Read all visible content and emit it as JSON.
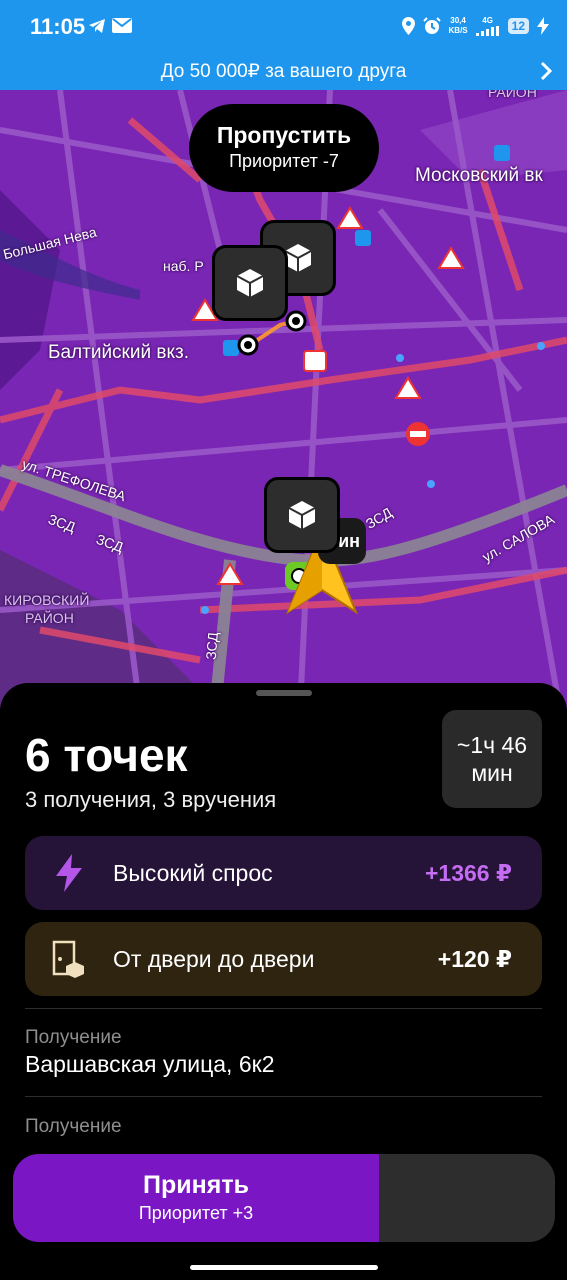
{
  "status_bar": {
    "time": "11:05",
    "net_speed_value": "30,4",
    "net_speed_unit": "KB/S",
    "network": "4G",
    "battery": "12"
  },
  "promo": {
    "text": "До 50 000₽ за вашего друга"
  },
  "map": {
    "skip_bubble": {
      "title": "Пропустить",
      "subtitle": "Приоритет -7"
    },
    "labels": {
      "moskovsky": "Московский вк",
      "bolshaya_neva": "Большая Нева",
      "naberezhnaya": "наб. Р",
      "baltiysky": "Балтийский вкз.",
      "trefoleva": "ул. ТРЕФОЛЕВА",
      "zsd_left": "ЗСД",
      "zsd_left2": "ЗСД",
      "zsd_vertical": "ЗСД",
      "zsd_right": "ЗСД",
      "salova": "ул. САЛОВА",
      "kirovsky": "КИРОВСКИЙ",
      "rayon": "РАЙОН",
      "rayon_top": "РАЙОН",
      "minute_badge": "ин"
    }
  },
  "sheet": {
    "title": "6 точек",
    "subtitle": "3 получения, 3 вручения",
    "time_line1": "~1ч 46",
    "time_line2": "мин",
    "bonuses": [
      {
        "label": "Высокий спрос",
        "value": "+1366 ₽"
      },
      {
        "label": "От двери до двери",
        "value": "+120 ₽"
      }
    ],
    "sections": [
      {
        "label": "Получение",
        "value": "Варшавская улица, 6к2"
      },
      {
        "label": "Получение",
        "value": ""
      }
    ],
    "accept": {
      "title": "Принять",
      "subtitle": "Приоритет +3"
    }
  },
  "colors": {
    "status_bar": "#1f96ee",
    "map_bg": "#7a26b4",
    "accent_purple": "#7a16c4",
    "demand_value": "#c46cf2"
  }
}
